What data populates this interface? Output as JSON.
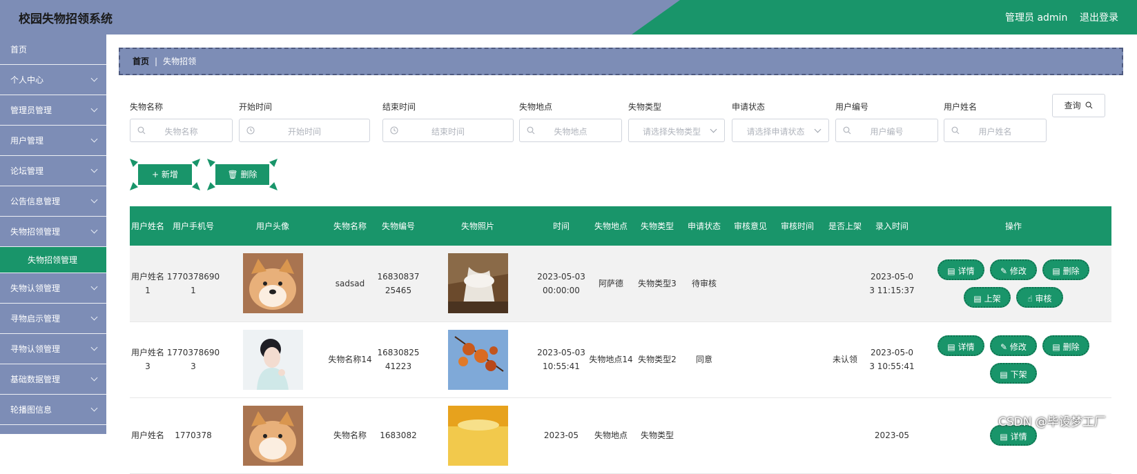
{
  "header": {
    "title": "校园失物招领系统",
    "admin_label": "管理员 admin",
    "logout_label": "退出登录",
    "colors": {
      "header_bg": "#7d8db6",
      "accent": "#19956a"
    }
  },
  "sidebar": {
    "items": [
      {
        "label": "首页"
      },
      {
        "label": "个人中心"
      },
      {
        "label": "管理员管理"
      },
      {
        "label": "用户管理"
      },
      {
        "label": "论坛管理"
      },
      {
        "label": "公告信息管理"
      },
      {
        "label": "失物招领管理"
      }
    ],
    "active_sub": "失物招领管理",
    "items_after": [
      {
        "label": "失物认领管理"
      },
      {
        "label": "寻物启示管理"
      },
      {
        "label": "寻物认领管理"
      },
      {
        "label": "基础数据管理"
      },
      {
        "label": "轮播图信息"
      }
    ]
  },
  "breadcrumb": {
    "home": "首页",
    "separator": "|",
    "current": "失物招领"
  },
  "filters": [
    {
      "label": "失物名称",
      "placeholder": "失物名称",
      "icon": "search-icon"
    },
    {
      "label": "开始时间",
      "placeholder": "开始时间",
      "icon": "clock-icon"
    },
    {
      "label": "结束时间",
      "placeholder": "结束时间",
      "icon": "clock-icon"
    },
    {
      "label": "失物地点",
      "placeholder": "失物地点",
      "icon": "search-icon"
    },
    {
      "label": "失物类型",
      "placeholder": "请选择失物类型",
      "icon": "chevron-down-icon"
    },
    {
      "label": "申请状态",
      "placeholder": "请选择申请状态",
      "icon": "chevron-down-icon"
    },
    {
      "label": "用户编号",
      "placeholder": "用户编号",
      "icon": "search-icon"
    },
    {
      "label": "用户姓名",
      "placeholder": "用户姓名",
      "icon": "search-icon"
    }
  ],
  "query_button": "查询",
  "actions": {
    "add": "新增",
    "delete": "删除"
  },
  "table": {
    "columns": [
      "用户姓名",
      "用户手机号",
      "用户头像",
      "失物名称",
      "失物编号",
      "失物照片",
      "时间",
      "失物地点",
      "失物类型",
      "申请状态",
      "审核意见",
      "审核时间",
      "是否上架",
      "录入时间",
      "操作"
    ],
    "rows": [
      {
        "user_name": "用户姓名1",
        "phone": "17703786901",
        "avatar": "shiba-avatar",
        "item_name": "sadsad",
        "item_no": "1683083725465",
        "photo": "waterfall-photo",
        "time": "2023-05-03 00:00:00",
        "place": "阿萨德",
        "type": "失物类型3",
        "status": "待审核",
        "review": "",
        "review_time": "",
        "listed": "",
        "entered": "2023-05-03 11:15:37",
        "ops": [
          "详情",
          "修改",
          "删除",
          "上架",
          "审核"
        ]
      },
      {
        "user_name": "用户姓名3",
        "phone": "17703786903",
        "avatar": "woman-avatar",
        "item_name": "失物名称14",
        "item_no": "1683082541223",
        "photo": "autumn-leaves-photo",
        "time": "2023-05-03 10:55:41",
        "place": "失物地点14",
        "type": "失物类型2",
        "status": "同意",
        "review": "",
        "review_time": "",
        "listed": "未认领",
        "entered": "2023-05-03 10:55:41",
        "ops": [
          "详情",
          "修改",
          "删除",
          "下架"
        ]
      },
      {
        "user_name": "用户姓名",
        "phone": "1770378",
        "avatar": "shiba-avatar",
        "item_name": "失物名称",
        "item_no": "1683082",
        "photo": "sunset-photo",
        "time": "2023-05",
        "place": "失物地点",
        "type": "失物类型",
        "status": "",
        "review": "",
        "review_time": "",
        "listed": "",
        "entered": "2023-05",
        "ops": [
          "详情"
        ]
      }
    ]
  },
  "watermark": "CSDN @毕设梦工厂"
}
